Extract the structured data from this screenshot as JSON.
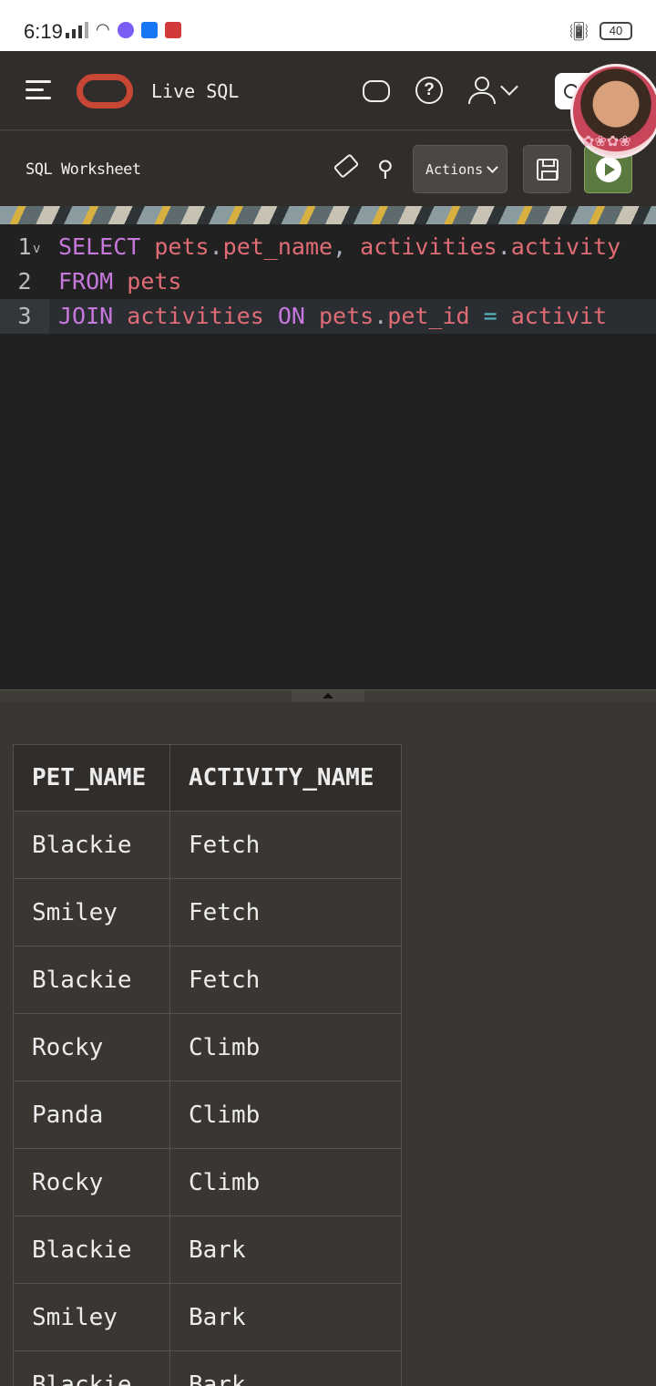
{
  "status_bar": {
    "time": "6:19",
    "battery": "40"
  },
  "header": {
    "app_title": "Live SQL"
  },
  "toolbar": {
    "worksheet_title": "SQL Worksheet",
    "actions_label": "Actions"
  },
  "editor": {
    "lines": [
      {
        "num": "1",
        "tokens": [
          {
            "t": "kw",
            "v": "SELECT "
          },
          {
            "t": "id",
            "v": "pets"
          },
          {
            "t": "pn",
            "v": "."
          },
          {
            "t": "id",
            "v": "pet_name"
          },
          {
            "t": "pn",
            "v": ", "
          },
          {
            "t": "id",
            "v": "activities"
          },
          {
            "t": "pn",
            "v": "."
          },
          {
            "t": "id",
            "v": "activity"
          }
        ]
      },
      {
        "num": "2",
        "tokens": [
          {
            "t": "kw",
            "v": "FROM "
          },
          {
            "t": "id",
            "v": "pets"
          }
        ]
      },
      {
        "num": "3",
        "tokens": [
          {
            "t": "kw",
            "v": "JOIN "
          },
          {
            "t": "id",
            "v": "activities "
          },
          {
            "t": "kw",
            "v": "ON "
          },
          {
            "t": "id",
            "v": "pets"
          },
          {
            "t": "pn",
            "v": "."
          },
          {
            "t": "id",
            "v": "pet_id "
          },
          {
            "t": "op",
            "v": "= "
          },
          {
            "t": "id",
            "v": "activit"
          }
        ]
      }
    ]
  },
  "results": {
    "columns": [
      "PET_NAME",
      "ACTIVITY_NAME"
    ],
    "rows": [
      [
        "Blackie",
        "Fetch"
      ],
      [
        "Smiley",
        "Fetch"
      ],
      [
        "Blackie",
        "Fetch"
      ],
      [
        "Rocky",
        "Climb"
      ],
      [
        "Panda",
        "Climb"
      ],
      [
        "Rocky",
        "Climb"
      ],
      [
        "Blackie",
        "Bark"
      ],
      [
        "Smiley",
        "Bark"
      ],
      [
        "Blackie",
        "Bark"
      ]
    ]
  },
  "colors": {
    "brand": "#c74634",
    "run_button": "#5a7a3f",
    "editor_bg": "#212121"
  }
}
